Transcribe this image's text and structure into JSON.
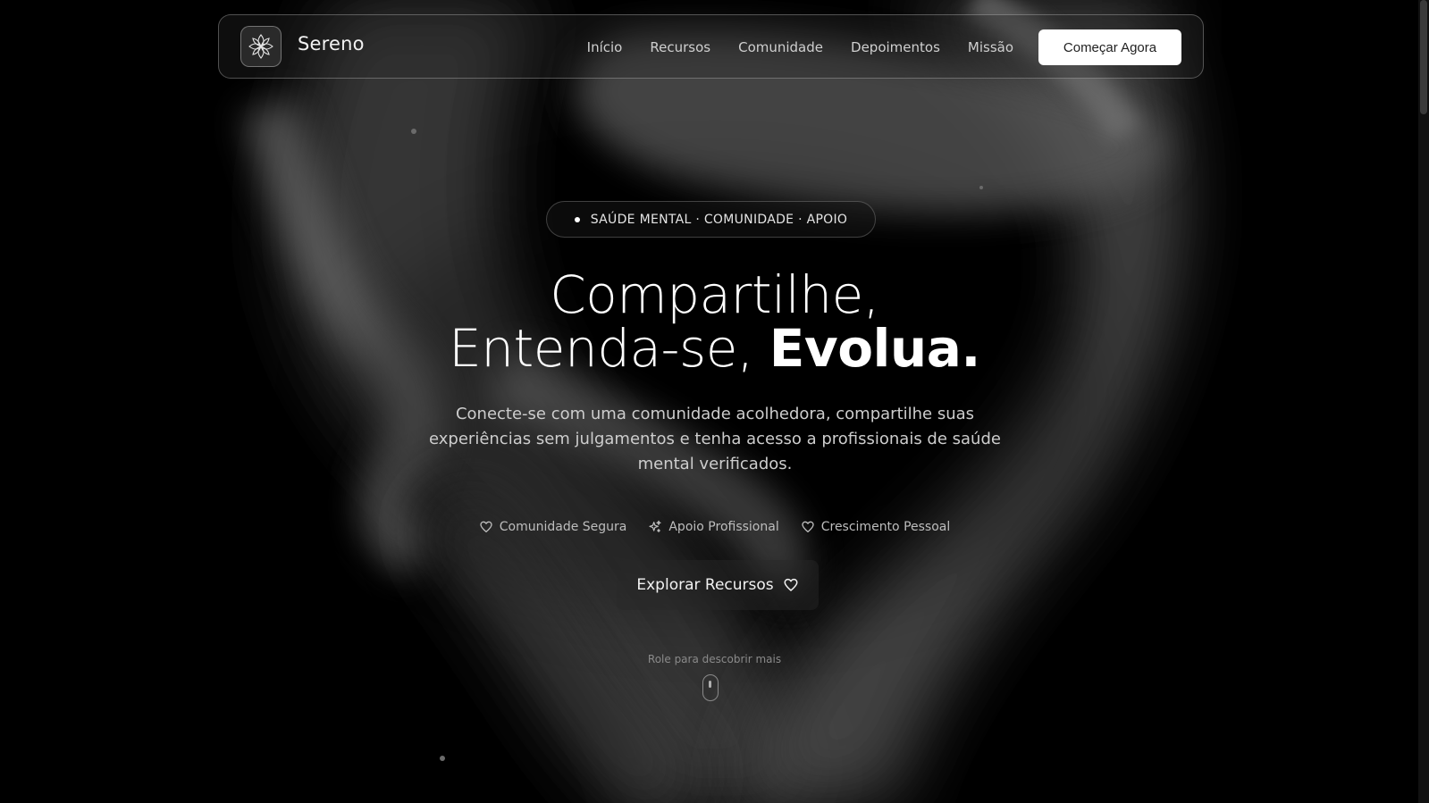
{
  "brand": {
    "name": "Sereno"
  },
  "nav": {
    "links": [
      "Início",
      "Recursos",
      "Comunidade",
      "Depoimentos",
      "Missão"
    ],
    "cta_label": "Começar Agora"
  },
  "hero": {
    "badge": "SAÚDE MENTAL · COMUNIDADE · APOIO",
    "headline_line1": "Compartilhe,",
    "headline_line2_regular": "Entenda-se, ",
    "headline_line2_bold": "Evolua.",
    "subtitle": "Conecte-se com uma comunidade acolhedora, compartilhe suas experiências sem julgamentos e tenha acesso a profissionais de saúde mental verificados.",
    "features": [
      {
        "label": "Comunidade Segura",
        "icon": "heart-icon"
      },
      {
        "label": "Apoio Profissional",
        "icon": "sparkles-icon"
      },
      {
        "label": "Crescimento Pessoal",
        "icon": "heart-icon"
      }
    ],
    "explore_label": "Explorar Recursos",
    "scroll_hint": "Role para descobrir mais"
  },
  "colors": {
    "background": "#000000",
    "text": "#ffffff",
    "muted_text": "#cdcdcd",
    "cta_background": "#ffffff"
  }
}
